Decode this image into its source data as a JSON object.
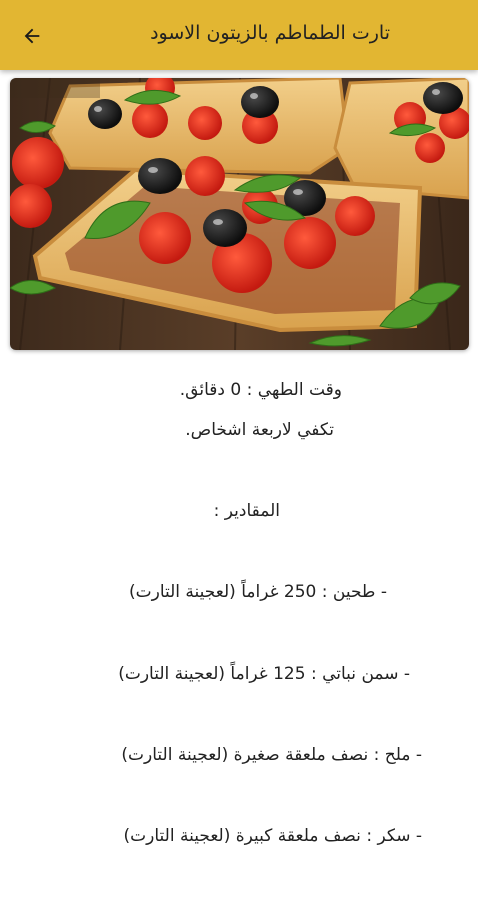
{
  "header": {
    "title": "تارت الطماطم بالزيتون الاسود",
    "back_icon": "arrow-left-icon",
    "background_color": "#e2b632"
  },
  "hero": {
    "image": "tomato-olive-tart-photo"
  },
  "recipe": {
    "cooking_time": "وقت الطهي : 0 دقائق.",
    "servings": "تكفي لاربعة اشخاص.",
    "ingredients_heading": "المقادير :",
    "ingredients": [
      "- طحين : 250 غراماً (لعجينة التارت)",
      "- سمن نباتي : 125 غراماً (لعجينة التارت)",
      "- ملح : نصف ملعقة صغيرة (لعجينة التارت)",
      "- سكر : نصف ملعقة كبيرة (لعجينة التارت)"
    ]
  }
}
